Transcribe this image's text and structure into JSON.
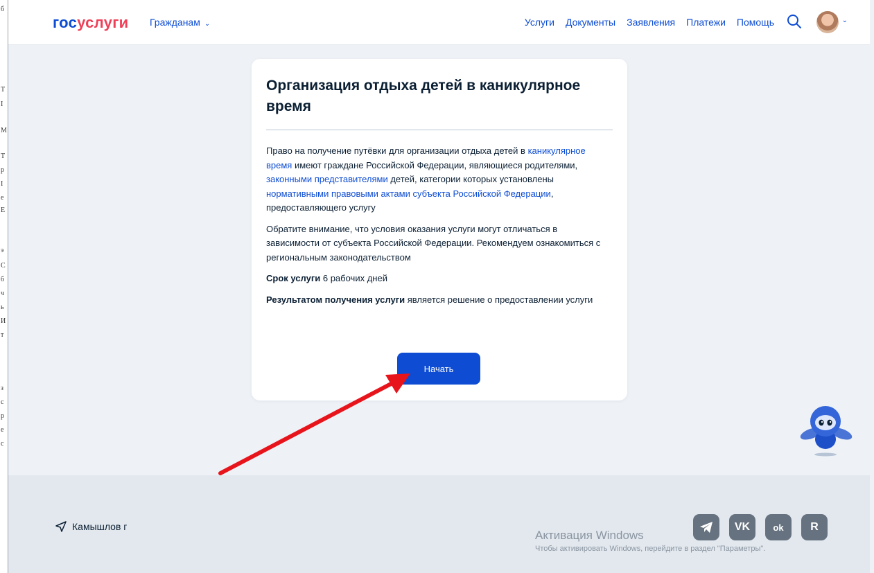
{
  "left_strip": {
    "chars": [
      "б",
      "Т",
      "I",
      "М",
      "Т",
      "р",
      "I",
      "е",
      "Е",
      "э",
      "С",
      "б",
      "ч",
      "ь",
      "И",
      "т",
      "з",
      "с",
      "р",
      "е",
      "с"
    ]
  },
  "header": {
    "logo": {
      "part1": "гос",
      "part2": "услуги"
    },
    "audience": "Гражданам",
    "nav": [
      "Услуги",
      "Документы",
      "Заявления",
      "Платежи",
      "Помощь"
    ],
    "icons": {
      "search": "search-icon",
      "chevron": "chevron-down-icon"
    }
  },
  "card": {
    "title": "Организация отдыха детей в каникулярное время",
    "p1": {
      "t1": "Право на получение путёвки для организации отдыха детей в ",
      "link1": "каникулярное время",
      "t2": " имеют граждане Российской Федерации, являющиеся родителями, ",
      "link2": "законными представителями",
      "t3": " детей, категории которых установлены ",
      "link3": "нормативными правовыми актами субъекта Российской Федерации",
      "t4": ", предоставляющего услугу"
    },
    "p2": "Обратите внимание, что условия оказания услуги могут отличаться в зависимости от субъекта Российской Федерации. Рекомендуем ознакомиться с региональным законодательством",
    "term": {
      "label": "Срок услуги",
      "value": " 6 рабочих дней"
    },
    "result": {
      "label": "Результатом получения услуги",
      "value": " является решение о предоставлении услуги"
    },
    "start_button": "Начать"
  },
  "footer": {
    "location": "Камышлов г",
    "social": [
      "telegram-icon",
      "vk-icon",
      "odnoklassniki-icon",
      "rutube-icon"
    ],
    "social_labels": {
      "vk": "VK",
      "ok": "ok",
      "rutube": "R"
    }
  },
  "watermark": {
    "title": "Активация Windows",
    "subtitle": "Чтобы активировать Windows, перейдите в раздел \"Параметры\"."
  },
  "colors": {
    "accent": "#0d4cd3",
    "logo_red": "#ee3f58",
    "arrow": "#e8141c",
    "background": "#eef2f7"
  }
}
